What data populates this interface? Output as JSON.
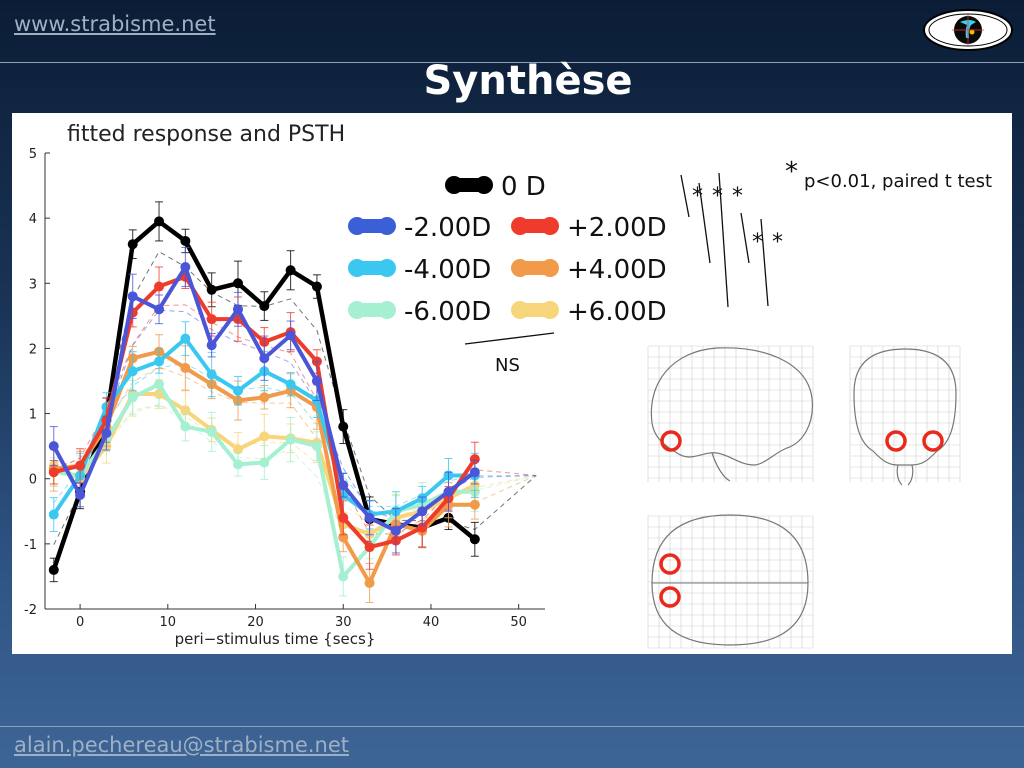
{
  "header": {
    "site_link": "www.strabisme.net"
  },
  "slide": {
    "title": "Synthèse"
  },
  "footer": {
    "email": "alain.pechereau@strabisme.net"
  },
  "chart_data": {
    "type": "line",
    "title": "fitted response and PSTH",
    "xlabel": "peri−stimulus time {secs}",
    "ylabel": "",
    "xlim": [
      -4,
      53
    ],
    "ylim": [
      -2,
      5
    ],
    "x_ticks": [
      0,
      10,
      20,
      30,
      40,
      50
    ],
    "y_ticks": [
      -2,
      -1,
      0,
      1,
      2,
      3,
      4,
      5
    ],
    "legend_position": "top-right",
    "x": [
      -3,
      0,
      3,
      6,
      9,
      12,
      15,
      18,
      21,
      24,
      27,
      30,
      33,
      36,
      39,
      42,
      45
    ],
    "series": [
      {
        "name": "0 D",
        "color": "#000000",
        "width": 4.5,
        "values": [
          -1.4,
          -0.2,
          0.9,
          3.6,
          3.95,
          3.65,
          2.9,
          3.0,
          2.65,
          3.2,
          2.95,
          0.8,
          -0.62,
          -0.7,
          -0.75,
          -0.6,
          -0.93
        ]
      },
      {
        "name": "+6.00D",
        "color": "#f7d57a",
        "width": 4,
        "values": [
          0.2,
          0.0,
          0.5,
          1.3,
          1.3,
          1.05,
          0.75,
          0.45,
          0.65,
          0.62,
          0.55,
          -0.7,
          -0.85,
          -0.6,
          -0.5,
          -0.3,
          -0.1
        ]
      },
      {
        "name": "-6.00D",
        "color": "#a5f0d0",
        "width": 4,
        "values": [
          0.1,
          0.05,
          0.6,
          1.25,
          1.45,
          0.8,
          0.72,
          0.22,
          0.25,
          0.6,
          0.5,
          -1.5,
          -1.05,
          -0.5,
          -0.4,
          -0.2,
          -0.2
        ]
      },
      {
        "name": "+4.00D",
        "color": "#f09a4a",
        "width": 4,
        "values": [
          0.15,
          0.2,
          0.8,
          1.85,
          1.95,
          1.7,
          1.45,
          1.2,
          1.25,
          1.35,
          1.1,
          -0.9,
          -1.6,
          -0.7,
          -0.8,
          -0.4,
          -0.4
        ]
      },
      {
        "name": "-4.00D",
        "color": "#3ac8f0",
        "width": 4,
        "values": [
          -0.55,
          0.05,
          1.1,
          1.65,
          1.8,
          2.15,
          1.6,
          1.35,
          1.65,
          1.45,
          1.2,
          -0.25,
          -0.55,
          -0.5,
          -0.3,
          0.05,
          0.05
        ]
      },
      {
        "name": "+2.00D",
        "color": "#ee3b2b",
        "width": 4,
        "values": [
          0.1,
          0.2,
          0.9,
          2.55,
          2.95,
          3.1,
          2.45,
          2.45,
          2.1,
          2.25,
          1.8,
          -0.6,
          -1.05,
          -0.95,
          -0.75,
          -0.3,
          0.3
        ]
      },
      {
        "name": "-2.00D",
        "color": "#4b55d8",
        "width": 4,
        "values": [
          0.5,
          -0.25,
          0.7,
          2.8,
          2.6,
          3.25,
          2.05,
          2.6,
          1.85,
          2.2,
          1.5,
          -0.1,
          -0.6,
          -0.8,
          -0.5,
          -0.2,
          0.1
        ]
      }
    ],
    "legend": [
      {
        "label": "0 D",
        "color": "#000000"
      },
      {
        "label": "-2.00D",
        "color": "#3a5fd6"
      },
      {
        "label": "+2.00D",
        "color": "#ee3b2b"
      },
      {
        "label": "-4.00D",
        "color": "#3ac8f0"
      },
      {
        "label": "+4.00D",
        "color": "#f09a4a"
      },
      {
        "label": "-6.00D",
        "color": "#a5f0d0"
      },
      {
        "label": "+6.00D",
        "color": "#f7d57a"
      }
    ],
    "annotations": {
      "significance_note": "p<0.01, paired t test",
      "star": "*",
      "ns_label": "NS"
    }
  }
}
